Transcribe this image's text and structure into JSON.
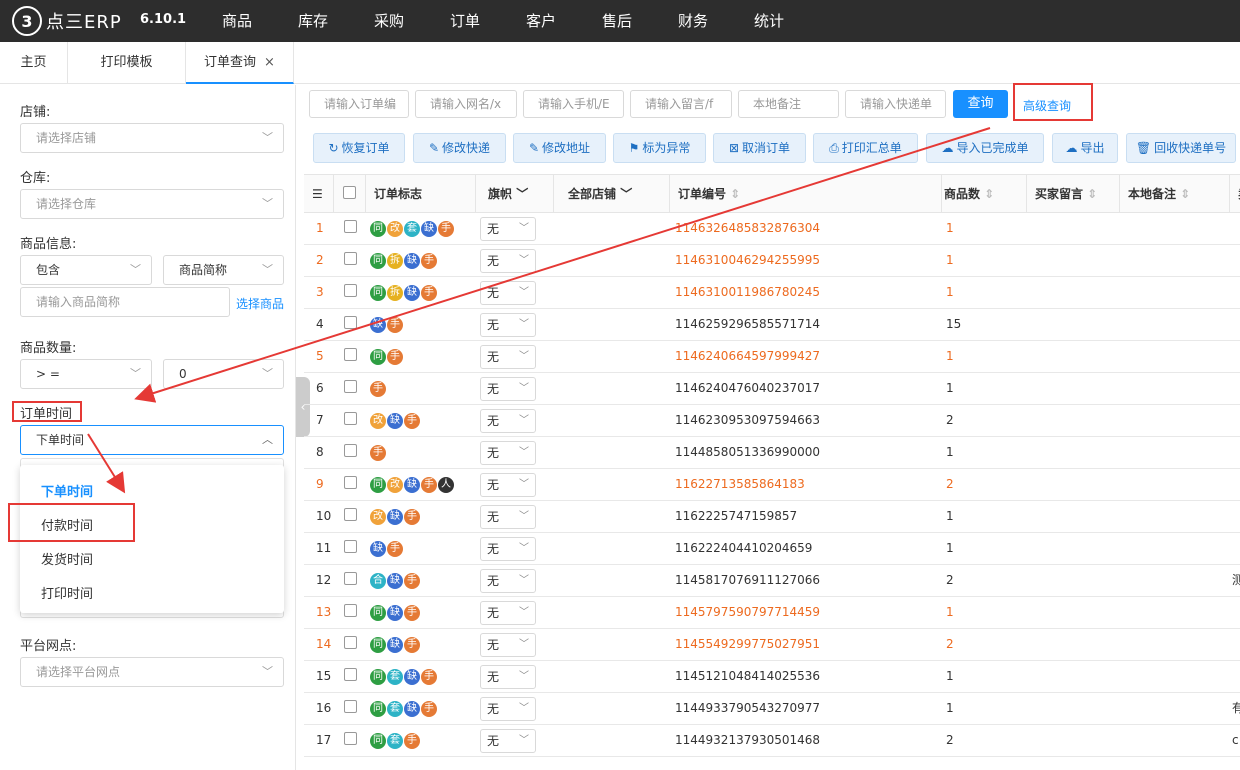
{
  "app": {
    "logo_mark": "3",
    "logo_text": "点三ERP",
    "version": "6.10.1"
  },
  "nav": {
    "items": [
      "商品",
      "库存",
      "采购",
      "订单",
      "客户",
      "售后",
      "财务",
      "统计"
    ]
  },
  "tabs": [
    {
      "label": "主页"
    },
    {
      "label": "打印模板"
    },
    {
      "label": "订单查询",
      "active": true,
      "close": "×"
    }
  ],
  "filters": {
    "shop_label": "店铺:",
    "shop_placeholder": "请选择店铺",
    "warehouse_label": "仓库:",
    "warehouse_placeholder": "请选择仓库",
    "goods_label": "商品信息:",
    "goods_match": "包含",
    "goods_field": "商品简称",
    "goods_input_placeholder": "请输入商品简称",
    "select_goods_link": "选择商品",
    "qty_label": "商品数量:",
    "qty_op": "> =",
    "qty_value": "0",
    "time_label": "订单时间",
    "time_selected": "下单时间",
    "time_options": [
      "下单时间",
      "付款时间",
      "发货时间",
      "打印时间"
    ],
    "outlet_label": "平台网点:",
    "outlet_placeholder": "请选择平台网点"
  },
  "search": {
    "placeholders": [
      "请输入订单编",
      "请输入网名/x",
      "请输入手机/E",
      "请输入留言/f",
      "本地备注",
      "请输入快递单"
    ],
    "query_button": "查询",
    "advanced_link": "高级查询"
  },
  "actions": [
    {
      "icon": "↻",
      "label": "恢复订单"
    },
    {
      "icon": "✎",
      "label": "修改快递"
    },
    {
      "icon": "✎",
      "label": "修改地址"
    },
    {
      "icon": "⚑",
      "label": "标为异常"
    },
    {
      "icon": "⊠",
      "label": "取消订单"
    },
    {
      "icon": "⎙",
      "label": "打印汇总单"
    },
    {
      "icon": "☁",
      "label": "导入已完成单"
    },
    {
      "icon": "☁",
      "label": "导出"
    },
    {
      "icon": "🗑",
      "label": "回收快递单号"
    }
  ],
  "table": {
    "headers": {
      "flags": "订单标志",
      "flag": "旗帜",
      "shop": "全部店铺",
      "order_no": "订单编号",
      "qty": "商品数",
      "buyer_msg": "买家留言",
      "local_note": "本地备注",
      "extra": "卖"
    },
    "flag_default": "无",
    "rows": [
      {
        "idx": "1",
        "badges": [
          "同",
          "改",
          "套",
          "缺",
          "手"
        ],
        "order": "1146326485832876304",
        "qty": "1",
        "hl": true,
        "extra": ""
      },
      {
        "idx": "2",
        "badges": [
          "同",
          "拆",
          "缺",
          "手"
        ],
        "order": "1146310046294255995",
        "qty": "1",
        "hl": true,
        "extra": ""
      },
      {
        "idx": "3",
        "badges": [
          "同",
          "拆",
          "缺",
          "手"
        ],
        "order": "1146310011986780245",
        "qty": "1",
        "hl": true,
        "extra": ""
      },
      {
        "idx": "4",
        "badges": [
          "缺",
          "手"
        ],
        "order": "1146259296585571714",
        "qty": "15",
        "hl": false,
        "extra": ""
      },
      {
        "idx": "5",
        "badges": [
          "同",
          "手"
        ],
        "order": "1146240664597999427",
        "qty": "1",
        "hl": true,
        "extra": ""
      },
      {
        "idx": "6",
        "badges": [
          "手"
        ],
        "order": "1146240476040237017",
        "qty": "1",
        "hl": false,
        "extra": ""
      },
      {
        "idx": "7",
        "badges": [
          "改",
          "缺",
          "手"
        ],
        "order": "1146230953097594663",
        "qty": "2",
        "hl": false,
        "extra": ""
      },
      {
        "idx": "8",
        "badges": [
          "手"
        ],
        "order": "1144858051336990000",
        "qty": "1",
        "hl": false,
        "extra": ""
      },
      {
        "idx": "9",
        "badges": [
          "同",
          "改",
          "缺",
          "手",
          "人"
        ],
        "order": "11622713585864183",
        "qty": "2",
        "hl": true,
        "extra": ""
      },
      {
        "idx": "10",
        "badges": [
          "改",
          "缺",
          "手"
        ],
        "order": "1162225747159857",
        "qty": "1",
        "hl": false,
        "extra": ""
      },
      {
        "idx": "11",
        "badges": [
          "缺",
          "手"
        ],
        "order": "116222404410204659",
        "qty": "1",
        "hl": false,
        "extra": ""
      },
      {
        "idx": "12",
        "badges": [
          "合",
          "缺",
          "手"
        ],
        "order": "1145817076911127066",
        "qty": "2",
        "hl": false,
        "extra": "测"
      },
      {
        "idx": "13",
        "badges": [
          "同",
          "缺",
          "手"
        ],
        "order": "1145797590797714459",
        "qty": "1",
        "hl": true,
        "extra": ""
      },
      {
        "idx": "14",
        "badges": [
          "同",
          "缺",
          "手"
        ],
        "order": "1145549299775027951",
        "qty": "2",
        "hl": true,
        "extra": ""
      },
      {
        "idx": "15",
        "badges": [
          "同",
          "套",
          "缺",
          "手"
        ],
        "order": "1145121048414025536",
        "qty": "1",
        "hl": false,
        "extra": ""
      },
      {
        "idx": "16",
        "badges": [
          "同",
          "套",
          "缺",
          "手"
        ],
        "order": "1144933790543270977",
        "qty": "1",
        "hl": false,
        "extra": "有"
      },
      {
        "idx": "17",
        "badges": [
          "同",
          "套",
          "手"
        ],
        "order": "1144932137930501468",
        "qty": "2",
        "hl": false,
        "extra": "c"
      }
    ]
  },
  "colors": {
    "accent": "#1890ff",
    "highlight_text": "#ed6a1f",
    "annotation_red": "#e53935",
    "badge": {
      "同": "#2e9e43",
      "改": "#f0a23a",
      "套": "#2db3c6",
      "缺": "#3b6fd1",
      "手": "#e57a35",
      "拆": "#e6b120",
      "合": "#2db3c6",
      "人": "#333333"
    }
  }
}
